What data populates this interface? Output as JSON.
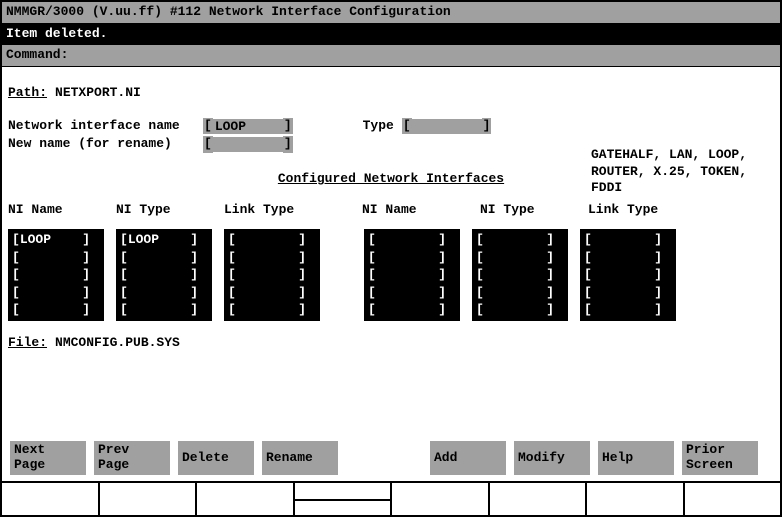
{
  "title": "NMMGR/3000 (V.uu.ff) #112  Network Interface Configuration",
  "status": "Item deleted.",
  "command_label": "Command:",
  "path_label": "Path:",
  "path_value": "NETXPORT.NI",
  "ni_name_label": "Network interface name",
  "ni_name_value": "LOOP    ",
  "new_name_label": "New name (for rename)",
  "new_name_value": "        ",
  "type_label": "Type",
  "type_value": "        ",
  "type_help_l1": "GATEHALF, LAN, LOOP,",
  "type_help_l2": "ROUTER, X.25, TOKEN,",
  "type_help_l3": "FDDI",
  "section_title": "Configured Network Interfaces",
  "headers": {
    "ni_name": "NI Name",
    "ni_type": "NI Type",
    "link_type": "Link Type"
  },
  "left_cols": {
    "ni_name": [
      "LOOP    ",
      "        ",
      "        ",
      "        ",
      "        "
    ],
    "ni_type": [
      "LOOP    ",
      "        ",
      "        ",
      "        ",
      "        "
    ],
    "link_type": [
      "        ",
      "        ",
      "        ",
      "        ",
      "        "
    ]
  },
  "right_cols": {
    "ni_name": [
      "        ",
      "        ",
      "        ",
      "        ",
      "        "
    ],
    "ni_type": [
      "        ",
      "        ",
      "        ",
      "        ",
      "        "
    ],
    "link_type": [
      "        ",
      "        ",
      "        ",
      "        ",
      "        "
    ]
  },
  "file_label": "File:",
  "file_value": "NMCONFIG.PUB.SYS",
  "fn": {
    "f1": "Next\nPage",
    "f2": "Prev\nPage",
    "f3": "Delete",
    "f4": "Rename",
    "f5": "Add",
    "f6": "Modify",
    "f7": "Help",
    "f8": "Prior\nScreen"
  }
}
